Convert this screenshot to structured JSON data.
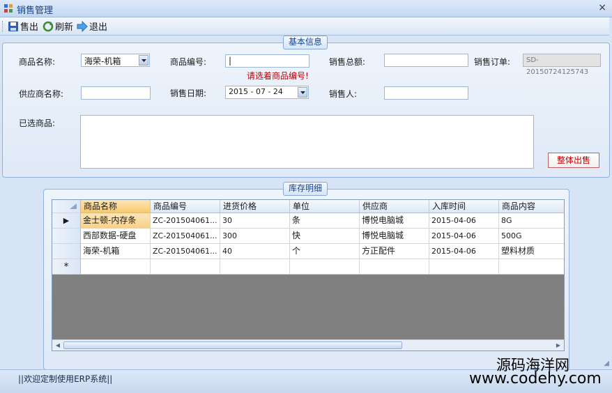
{
  "window": {
    "title": "销售管理",
    "close": "×"
  },
  "toolbar": {
    "sell": "售出",
    "refresh": "刷新",
    "exit": "退出"
  },
  "basic": {
    "legend": "基本信息",
    "product_name_label": "商品名称:",
    "product_name_value": "海荣-机箱",
    "product_code_label": "商品编号:",
    "product_code_value": "|",
    "product_code_warning": "请选着商品编号!",
    "total_label": "销售总额:",
    "total_value": "",
    "order_label": "销售订单:",
    "order_value": "SD-20150724125743",
    "supplier_label": "供应商名称:",
    "supplier_value": "",
    "date_label": "销售日期:",
    "date_value": "2015 - 07 - 24",
    "seller_label": "销售人:",
    "seller_value": "",
    "selected_label": "已选商品:",
    "whole_sell_button": "整体出售"
  },
  "stock": {
    "legend": "库存明细",
    "columns": [
      "商品名称",
      "商品编号",
      "进货价格",
      "单位",
      "供应商",
      "入库时间",
      "商品内容"
    ],
    "rows": [
      [
        "金士顿-内存条",
        "ZC-201504061...",
        "30",
        "条",
        "博悦电脑城",
        "2015-04-06",
        "8G"
      ],
      [
        "西部数据-硬盘",
        "ZC-201504061...",
        "300",
        "快",
        "博悦电脑城",
        "2015-04-06",
        "500G"
      ],
      [
        "海荣-机箱",
        "ZC-201504061...",
        "40",
        "个",
        "方正配件",
        "2015-04-06",
        "塑料材质"
      ]
    ],
    "current_row_marker": "▶",
    "new_row_marker": "*"
  },
  "status": {
    "text": "||欢迎定制使用ERP系统||"
  },
  "watermark": {
    "line1": "源码海洋网",
    "line2": "www.codehy.com"
  }
}
